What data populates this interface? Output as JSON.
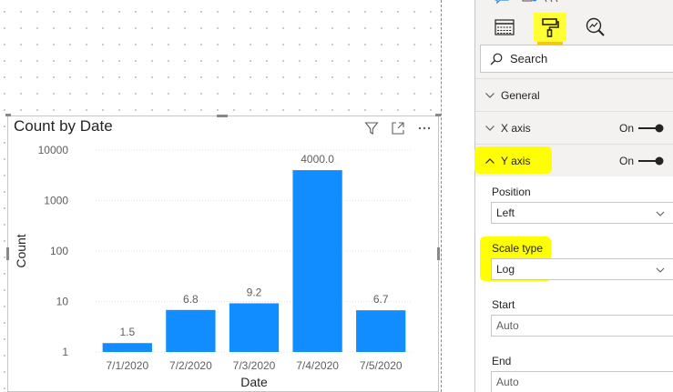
{
  "visual": {
    "title": "Count by Date",
    "icons": [
      "filter-icon",
      "focus-mode-icon",
      "more-options-icon"
    ]
  },
  "chart_data": {
    "type": "bar",
    "title": "Count by Date",
    "xlabel": "Date",
    "ylabel": "Count",
    "categories": [
      "7/1/2020",
      "7/2/2020",
      "7/3/2020",
      "7/4/2020",
      "7/5/2020"
    ],
    "values": [
      1.5,
      6.8,
      9.2,
      4000.0,
      6.7
    ],
    "data_labels": [
      "1.5",
      "6.8",
      "9.2",
      "4000.0",
      "6.7"
    ],
    "y_scale": "log",
    "ylim": [
      1,
      10000
    ],
    "y_ticks": [
      1,
      10,
      100,
      1000,
      10000
    ],
    "y_tick_labels": [
      "1",
      "10",
      "100",
      "1000",
      "10000"
    ],
    "grid": true,
    "bar_color": "#118DFF"
  },
  "pane": {
    "tabs": [
      {
        "icon": "fields-icon",
        "active": false
      },
      {
        "icon": "paint-roller-icon",
        "active": true
      },
      {
        "icon": "analytics-icon",
        "active": false
      }
    ],
    "search_placeholder": "Search",
    "sections": {
      "general": {
        "label": "General",
        "expanded": false
      },
      "x_axis": {
        "label": "X axis",
        "toggle_label": "On",
        "expanded": false,
        "on": true
      },
      "y_axis": {
        "label": "Y axis",
        "toggle_label": "On",
        "expanded": true,
        "on": true
      }
    },
    "fields": {
      "position": {
        "label": "Position",
        "value": "Left"
      },
      "scale_type": {
        "label": "Scale type",
        "value": "Log"
      },
      "start": {
        "label": "Start",
        "value": "Auto"
      },
      "end": {
        "label": "End",
        "value": "Auto"
      }
    },
    "highlight_color": "#FFFF00",
    "accent_color": "#F2C811"
  }
}
